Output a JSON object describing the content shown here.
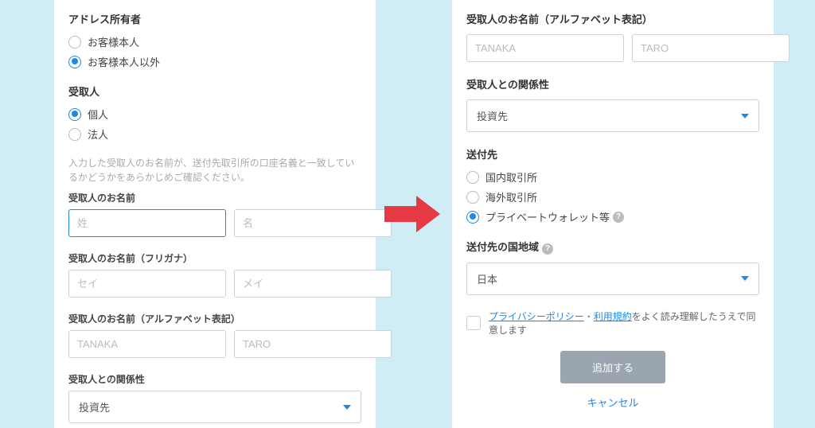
{
  "left": {
    "addressOwner": {
      "title": "アドレス所有者",
      "options": [
        "お客様本人",
        "お客様本人以外"
      ],
      "selected": 1
    },
    "recipient": {
      "title": "受取人",
      "options": [
        "個人",
        "法人"
      ],
      "selected": 0
    },
    "nameHelp": "入力した受取人のお名前が、送付先取引所の口座名義と一致しているかどうかをあらかじめご確認ください。",
    "nameTitle": "受取人のお名前",
    "namePlaceholders": [
      "姓",
      "名"
    ],
    "kanaTitle": "受取人のお名前（フリガナ）",
    "kanaPlaceholders": [
      "セイ",
      "メイ"
    ],
    "alphaTitle": "受取人のお名前（アルファベット表記）",
    "alphaPlaceholders": [
      "TANAKA",
      "TARO"
    ],
    "relationTitle": "受取人との関係性",
    "relationValue": "投資先"
  },
  "right": {
    "alphaTitle": "受取人のお名前（アルファベット表記）",
    "alphaPlaceholders": [
      "TANAKA",
      "TARO"
    ],
    "relationTitle": "受取人との関係性",
    "relationValue": "投資先",
    "destination": {
      "title": "送付先",
      "options": [
        "国内取引所",
        "海外取引所",
        "プライベートウォレット等"
      ],
      "selected": 2
    },
    "regionTitle": "送付先の国地域",
    "regionValue": "日本",
    "policyLink": "プライバシーポリシー",
    "termsLink": "利用規約",
    "agreeText": "をよく読み理解したうえで同意します",
    "addButton": "追加する",
    "cancelButton": "キャンセル"
  }
}
